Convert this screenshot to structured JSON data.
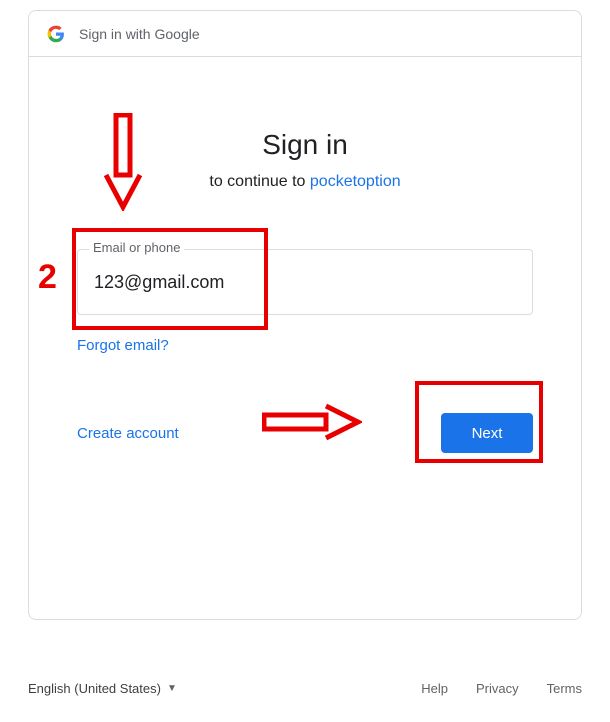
{
  "header": {
    "title": "Sign in with Google"
  },
  "main": {
    "heading": "Sign in",
    "subheading_prefix": "to continue to ",
    "subheading_app": "pocketoption",
    "email_label": "Email or phone",
    "email_value": "123@gmail.com",
    "forgot_email": "Forgot email?",
    "create_account": "Create account",
    "next_button": "Next"
  },
  "footer": {
    "language": "English (United States)",
    "links": {
      "help": "Help",
      "privacy": "Privacy",
      "terms": "Terms"
    }
  },
  "annotations": {
    "step_number": "2"
  }
}
